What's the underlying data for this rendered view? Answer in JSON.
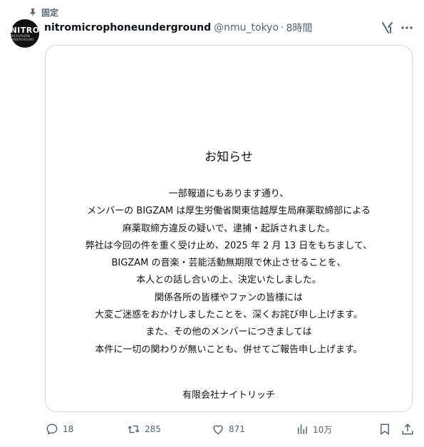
{
  "pinned": {
    "label": "固定",
    "icon": "pin-icon"
  },
  "author": {
    "avatar": {
      "logo_big": "NITRO",
      "logo_small": "MICROPHONE UNDERGROUND"
    },
    "name": "nitromicrophoneunderground",
    "handle": "@nmu_tokyo",
    "separator": "·",
    "time": "8時間"
  },
  "header_icons": {
    "grok": "grok-icon",
    "more": "more-icon"
  },
  "notice": {
    "title": "お知らせ",
    "lines": [
      "一部報道にもあります通り、",
      "メンバーの BIGZAM は厚生労働省関東信越厚生局麻薬取締部による",
      "麻薬取締方違反の疑いで、逮捕・起訴されました。",
      "弊社は今回の件を重く受け止め、2025 年 2 月 13 日をもちまして、",
      "BIGZAM の音楽・芸能活動無期限で休止させることを、",
      "本人との話し合いの上、決定いたしました。",
      "関係各所の皆様やファンの皆様には",
      "大変ご迷惑をおかけしましたことを、深くお詫び申し上げます。",
      "また、その他のメンバーにつきましては",
      "本件に一切の関わりが無いことも、併せてご報告申し上げます。"
    ],
    "signature": "有限会社ナイトリッチ"
  },
  "actions": {
    "reply": {
      "icon": "reply-icon",
      "count": "18"
    },
    "repost": {
      "icon": "repost-icon",
      "count": "285"
    },
    "like": {
      "icon": "like-icon",
      "count": "871"
    },
    "views": {
      "icon": "views-icon",
      "count": "10万"
    },
    "bookmark": {
      "icon": "bookmark-icon"
    },
    "share": {
      "icon": "share-icon"
    }
  },
  "colors": {
    "text": "#0f1419",
    "secondary": "#536471",
    "border": "#cfd9de"
  }
}
